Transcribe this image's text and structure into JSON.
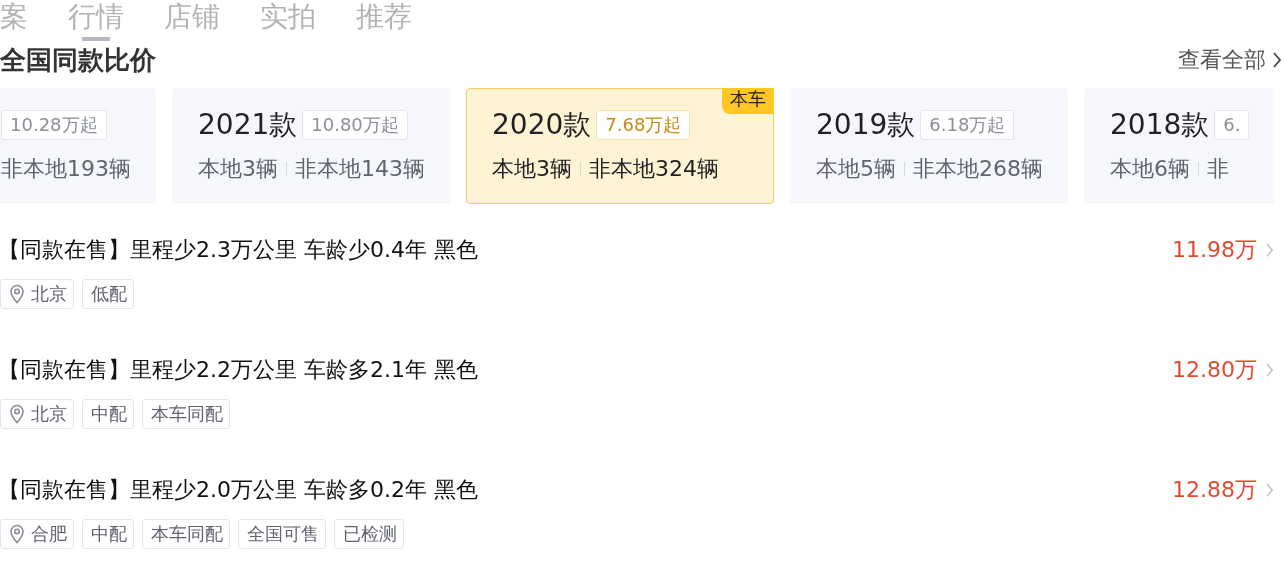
{
  "header": {
    "tabs": [
      {
        "label": "案",
        "selected": false
      },
      {
        "label": "行情",
        "selected": true
      },
      {
        "label": "店铺",
        "selected": false
      },
      {
        "label": "实拍",
        "selected": false
      },
      {
        "label": "推荐",
        "selected": false
      }
    ],
    "title": "全国同款比价",
    "view_all": "查看全部"
  },
  "year_cards": [
    {
      "price": "10.28万起",
      "nonlocal": "非本地193辆",
      "selected": false
    },
    {
      "year": "2021款",
      "price": "10.80万起",
      "local": "本地3辆",
      "nonlocal": "非本地143辆",
      "selected": false
    },
    {
      "year": "2020款",
      "price": "7.68万起",
      "local": "本地3辆",
      "nonlocal": "非本地324辆",
      "selected": true,
      "badge": "本车"
    },
    {
      "year": "2019款",
      "price": "6.18万起",
      "local": "本地5辆",
      "nonlocal": "非本地268辆",
      "selected": false
    },
    {
      "year": "2018款",
      "price": "6.",
      "local": "本地6辆",
      "nonlocal": "非",
      "selected": false
    }
  ],
  "listings": [
    {
      "title": "【同款在售】里程少2.3万公里 车龄少0.4年 黑色",
      "price": "11.98万",
      "tags": [
        {
          "kind": "location",
          "label": "北京"
        },
        {
          "kind": "plain",
          "label": "低配"
        }
      ]
    },
    {
      "title": "【同款在售】里程少2.2万公里 车龄多2.1年 黑色",
      "price": "12.80万",
      "tags": [
        {
          "kind": "location",
          "label": "北京"
        },
        {
          "kind": "plain",
          "label": "中配"
        },
        {
          "kind": "plain",
          "label": "本车同配"
        }
      ]
    },
    {
      "title": "【同款在售】里程少2.0万公里 车龄多0.2年 黑色",
      "price": "12.88万",
      "tags": [
        {
          "kind": "location",
          "label": "合肥"
        },
        {
          "kind": "plain",
          "label": "中配"
        },
        {
          "kind": "plain",
          "label": "本车同配"
        },
        {
          "kind": "plain",
          "label": "全国可售"
        },
        {
          "kind": "plain",
          "label": "已检测"
        }
      ]
    }
  ]
}
